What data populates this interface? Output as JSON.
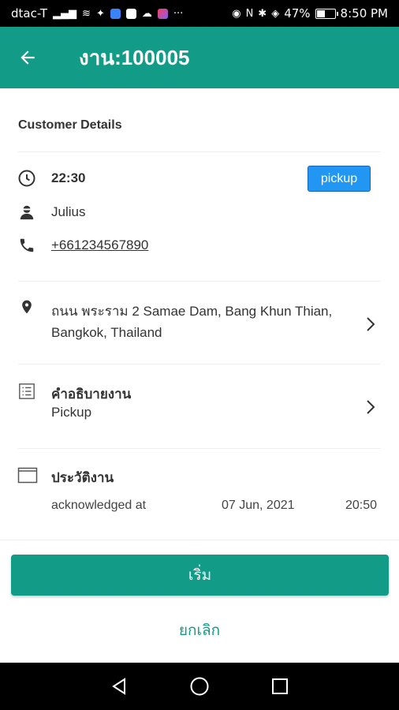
{
  "status_bar": {
    "carrier": "dtac-T",
    "battery_percent": "47%",
    "battery_level": 0.47,
    "time": "8:50 PM"
  },
  "app_bar": {
    "title": "งาน:100005"
  },
  "customer": {
    "section_title": "Customer Details",
    "time": "22:30",
    "type_badge": "pickup",
    "name": "Julius",
    "phone": "+661234567890"
  },
  "address": {
    "line1": "ถนน พระราม 2 Samae Dam, Bang Khun Thian,",
    "line2": "Bangkok, Thailand"
  },
  "description": {
    "title": "คำอธิบายงาน",
    "value": "Pickup"
  },
  "history": {
    "title": "ประวัติงาน",
    "entries": [
      {
        "label": "acknowledged at",
        "date": "07 Jun, 2021",
        "time": "20:50"
      }
    ]
  },
  "actions": {
    "start_label": "เริ่ม",
    "cancel_label": "ยกเลิก"
  },
  "colors": {
    "primary": "#129b86",
    "badge": "#2196f3"
  },
  "icons": [
    "clock-icon",
    "person-icon",
    "phone-icon",
    "location-pin-icon",
    "list-icon",
    "calendar-icon",
    "chevron-right-icon",
    "arrow-back-icon"
  ]
}
